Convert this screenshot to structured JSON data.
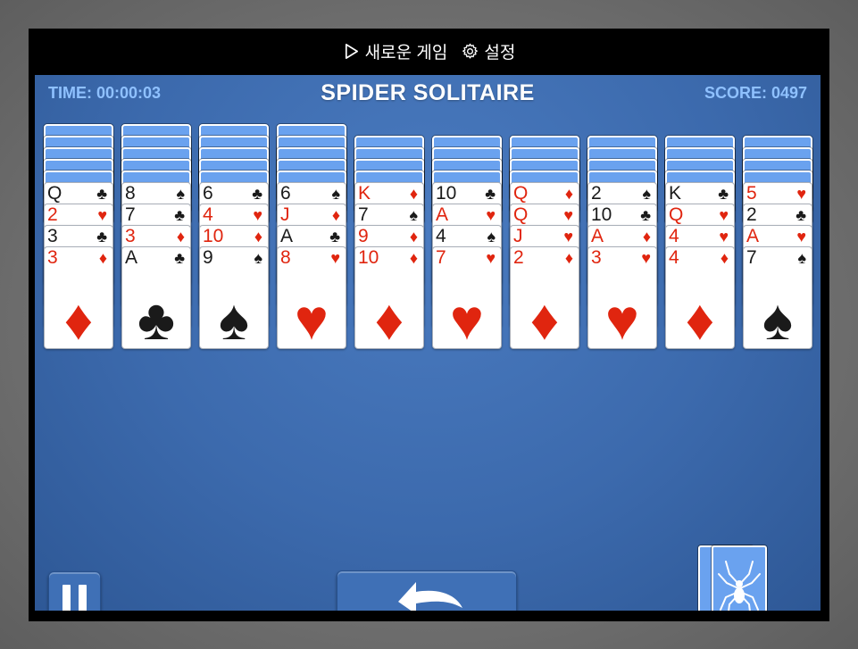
{
  "menu": {
    "new_game_label": "새로운 게임",
    "settings_label": "설정"
  },
  "hud": {
    "time": "TIME: 00:00:03",
    "title": "SPIDER SOLITAIRE",
    "score": "SCORE: 0497"
  },
  "colors": {
    "board": "#3c6aad",
    "card_back": "#6aa2ef",
    "red_suit": "#e0250f",
    "black_suit": "#1a1a1a",
    "hud_text": "#8fc1ff"
  },
  "tableau": [
    {
      "hidden": 5,
      "cards": [
        {
          "rank": "Q",
          "suit": "♣"
        },
        {
          "rank": "2",
          "suit": "♥"
        },
        {
          "rank": "3",
          "suit": "♣"
        },
        {
          "rank": "3",
          "suit": "♦"
        }
      ]
    },
    {
      "hidden": 5,
      "cards": [
        {
          "rank": "8",
          "suit": "♠"
        },
        {
          "rank": "7",
          "suit": "♣"
        },
        {
          "rank": "3",
          "suit": "♦"
        },
        {
          "rank": "A",
          "suit": "♣"
        }
      ]
    },
    {
      "hidden": 5,
      "cards": [
        {
          "rank": "6",
          "suit": "♣"
        },
        {
          "rank": "4",
          "suit": "♥"
        },
        {
          "rank": "10",
          "suit": "♦"
        },
        {
          "rank": "9",
          "suit": "♠"
        }
      ]
    },
    {
      "hidden": 5,
      "cards": [
        {
          "rank": "6",
          "suit": "♠"
        },
        {
          "rank": "J",
          "suit": "♦"
        },
        {
          "rank": "A",
          "suit": "♣"
        },
        {
          "rank": "8",
          "suit": "♥"
        }
      ]
    },
    {
      "hidden": 4,
      "cards": [
        {
          "rank": "K",
          "suit": "♦"
        },
        {
          "rank": "7",
          "suit": "♠"
        },
        {
          "rank": "9",
          "suit": "♦"
        },
        {
          "rank": "10",
          "suit": "♦"
        }
      ]
    },
    {
      "hidden": 4,
      "cards": [
        {
          "rank": "10",
          "suit": "♣"
        },
        {
          "rank": "A",
          "suit": "♥"
        },
        {
          "rank": "4",
          "suit": "♠"
        },
        {
          "rank": "7",
          "suit": "♥"
        }
      ]
    },
    {
      "hidden": 4,
      "cards": [
        {
          "rank": "Q",
          "suit": "♦"
        },
        {
          "rank": "Q",
          "suit": "♥"
        },
        {
          "rank": "J",
          "suit": "♥"
        },
        {
          "rank": "2",
          "suit": "♦"
        }
      ]
    },
    {
      "hidden": 4,
      "cards": [
        {
          "rank": "2",
          "suit": "♠"
        },
        {
          "rank": "10",
          "suit": "♣"
        },
        {
          "rank": "A",
          "suit": "♦"
        },
        {
          "rank": "3",
          "suit": "♥"
        }
      ]
    },
    {
      "hidden": 4,
      "cards": [
        {
          "rank": "K",
          "suit": "♣"
        },
        {
          "rank": "Q",
          "suit": "♥"
        },
        {
          "rank": "4",
          "suit": "♥"
        },
        {
          "rank": "4",
          "suit": "♦"
        }
      ]
    },
    {
      "hidden": 4,
      "cards": [
        {
          "rank": "5",
          "suit": "♥"
        },
        {
          "rank": "2",
          "suit": "♣"
        },
        {
          "rank": "A",
          "suit": "♥"
        },
        {
          "rank": "7",
          "suit": "♠"
        }
      ]
    }
  ],
  "stock": {
    "deals_remaining": 2,
    "icon": "spider-icon"
  },
  "controls": {
    "pause_icon": "pause-icon",
    "undo_icon": "undo-arrow-icon"
  }
}
